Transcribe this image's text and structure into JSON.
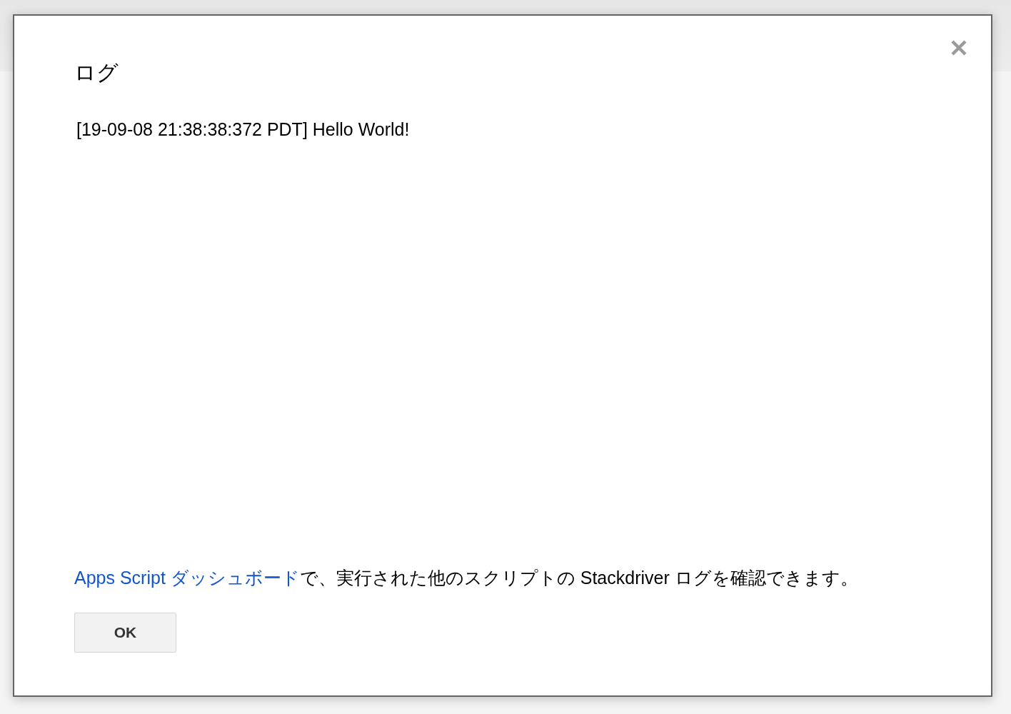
{
  "dialog": {
    "title": "ログ",
    "log_lines": [
      "[19-09-08 21:38:38:372 PDT] Hello World!"
    ],
    "footer": {
      "link": "Apps Script ダッシュボード",
      "text": "で、実行された他のスクリプトの Stackdriver ログを確認できます。"
    },
    "buttons": [
      "OK"
    ]
  }
}
